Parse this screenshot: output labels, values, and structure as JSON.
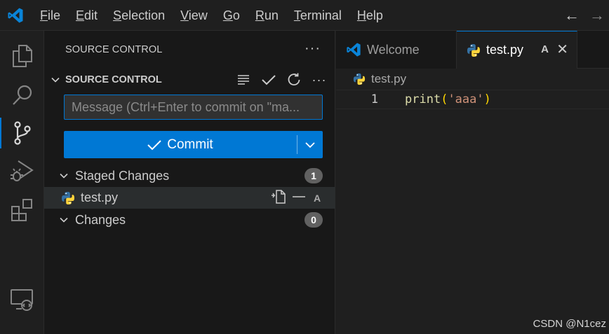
{
  "menu": {
    "items": [
      {
        "mn": "F",
        "rest": "ile"
      },
      {
        "mn": "E",
        "rest": "dit"
      },
      {
        "mn": "S",
        "rest": "election"
      },
      {
        "mn": "V",
        "rest": "iew"
      },
      {
        "mn": "G",
        "rest": "o"
      },
      {
        "mn": "R",
        "rest": "un"
      },
      {
        "mn": "T",
        "rest": "erminal"
      },
      {
        "mn": "H",
        "rest": "elp"
      }
    ]
  },
  "nav": {
    "back": "←",
    "forward": "→"
  },
  "activity_bar": {
    "items": [
      "explorer-icon",
      "search-icon",
      "source-control-icon",
      "run-debug-icon",
      "extensions-icon",
      "remote-explorer-icon"
    ],
    "active": "source-control-icon"
  },
  "sidebar": {
    "header_title": "SOURCE CONTROL",
    "more": "···",
    "section_title": "SOURCE CONTROL",
    "message_placeholder": "Message (Ctrl+Enter to commit on \"ma...",
    "message_value": "",
    "commit_label": "Commit",
    "staged": {
      "label": "Staged Changes",
      "count": "1"
    },
    "staged_files": [
      {
        "name": "test.py",
        "status": "A"
      }
    ],
    "changes": {
      "label": "Changes",
      "count": "0"
    }
  },
  "editor": {
    "tabs": [
      {
        "label": "Welcome",
        "active": false
      },
      {
        "label": "test.py",
        "active": true,
        "status": "A",
        "close": "✕"
      }
    ],
    "breadcrumb": "test.py",
    "lines": [
      {
        "number": "1",
        "fn": "print",
        "open": "(",
        "str": "'aaa'",
        "close": ")"
      }
    ]
  },
  "watermark": "CSDN @N1cez",
  "colors": {
    "accent": "#0078d4",
    "python_blue": "#3572a5",
    "python_yellow": "#ffd43b",
    "string": "#ce9178",
    "function": "#dcdcaa"
  }
}
